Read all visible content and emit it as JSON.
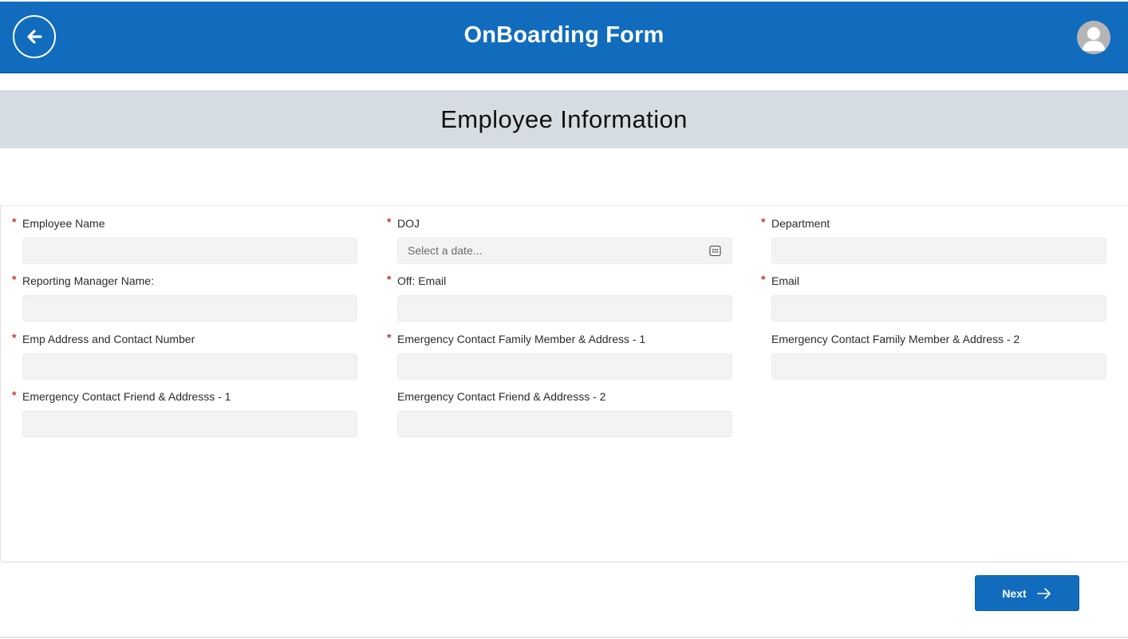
{
  "header": {
    "title": "OnBoarding Form",
    "brand_color": "#116cbd"
  },
  "section": {
    "title": "Employee Information"
  },
  "fields": [
    {
      "label": "Employee Name",
      "required": true,
      "value": ""
    },
    {
      "label": "DOJ",
      "required": true,
      "placeholder": "Select a date...",
      "icon": "calendar-icon"
    },
    {
      "label": "Department",
      "required": true,
      "value": ""
    },
    {
      "label": "Reporting Manager Name:",
      "required": true,
      "value": ""
    },
    {
      "label": "Off: Email",
      "required": true,
      "value": ""
    },
    {
      "label": "Email",
      "required": true,
      "value": ""
    },
    {
      "label": "Emp Address and Contact Number",
      "required": true,
      "value": ""
    },
    {
      "label": "Emergency Contact Family Member & Address - 1",
      "required": true,
      "value": ""
    },
    {
      "label": "Emergency Contact Family Member & Address - 2",
      "required": false,
      "value": ""
    },
    {
      "label": "Emergency Contact Friend & Addresss - 1",
      "required": true,
      "value": ""
    },
    {
      "label": "Emergency Contact Friend & Addresss - 2",
      "required": false,
      "value": ""
    }
  ],
  "required_marker": "*",
  "footer": {
    "next_label": "Next"
  },
  "icons": {
    "back": "arrow-left-icon",
    "avatar": "user-avatar-icon",
    "next": "arrow-right-icon"
  }
}
